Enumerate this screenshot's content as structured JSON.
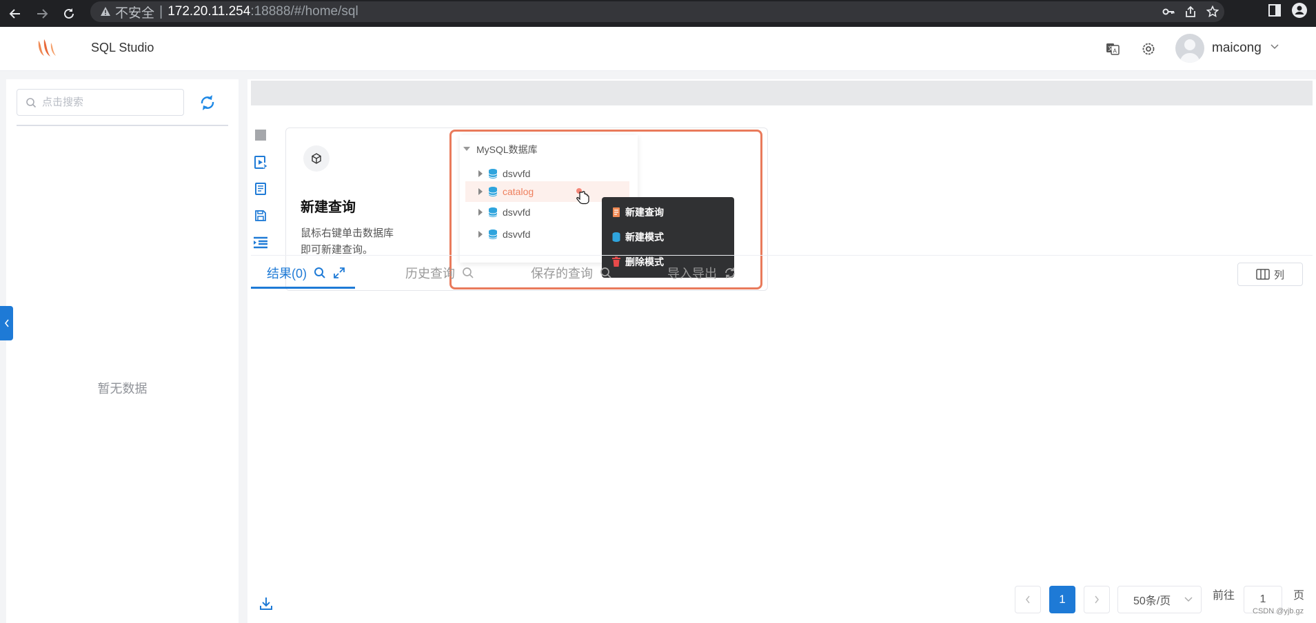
{
  "browser": {
    "insecure_label": "不安全",
    "url_host": "172.20.11.254",
    "url_rest": ":18888/#/home/sql"
  },
  "header": {
    "app_title": "SQL Studio",
    "username": "maicong"
  },
  "sidebar": {
    "search_placeholder": "点击搜索",
    "empty_text": "暂无数据"
  },
  "guide": {
    "title": "新建查询",
    "desc_line1": "鼠标右键单击数据库",
    "desc_line2": "即可新建查询。",
    "tree_root": "MySQL数据库",
    "tree_items": [
      "dsvvfd",
      "catalog",
      "dsvvfd",
      "dsvvfd"
    ],
    "context_menu": [
      "新建查询",
      "新建模式",
      "删除模式"
    ]
  },
  "tabs": [
    {
      "label": "结果(0)",
      "active": true
    },
    {
      "label": "历史查询",
      "active": false
    },
    {
      "label": "保存的查询",
      "active": false
    },
    {
      "label": "导入导出",
      "active": false
    }
  ],
  "columns_button": "列",
  "pagination": {
    "current_page": "1",
    "page_size": "50条/页",
    "goto_label": "前往",
    "goto_value": "1",
    "page_unit": "页"
  },
  "watermark": "CSDN @yjb.gz",
  "colors": {
    "primary": "#1e7ad6",
    "highlight": "#e97a5b",
    "menu_bg": "#303133"
  }
}
